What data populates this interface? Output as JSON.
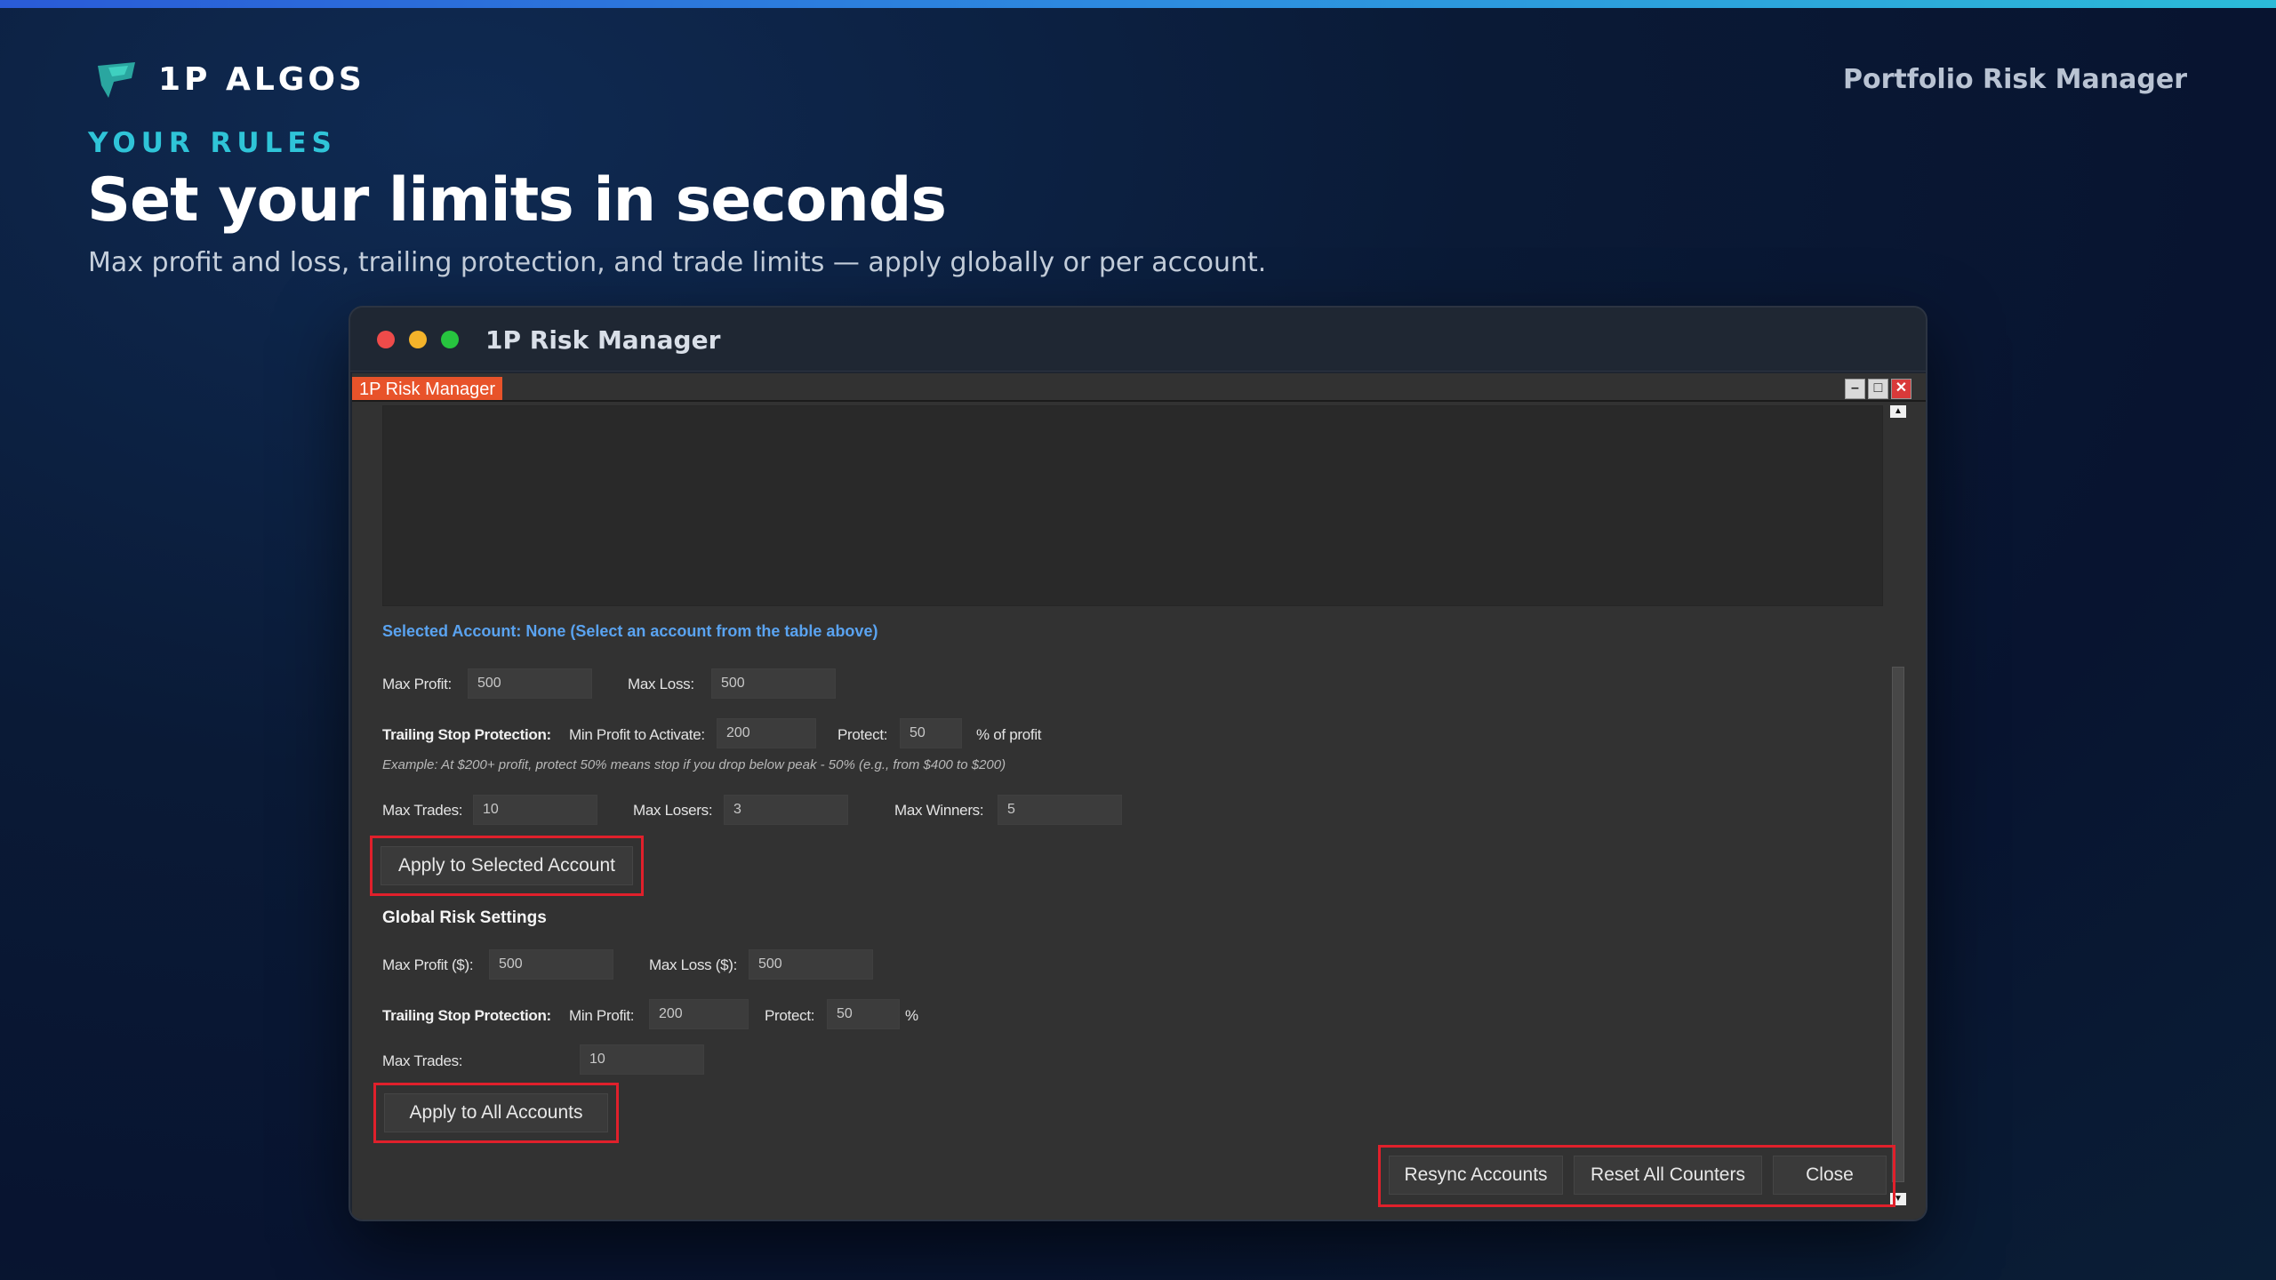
{
  "colors": {
    "accent_cyan": "#2fc4d8",
    "tab_orange": "#e8532a",
    "highlight_red": "#e0202b",
    "link_blue": "#5aa3f0"
  },
  "header": {
    "brand": "1P ALGOS",
    "brand_icon": "1p-logo-icon",
    "right_label": "Portfolio Risk Manager"
  },
  "hero": {
    "kicker": "YOUR RULES",
    "headline": "Set your limits in seconds",
    "subhead": "Max profit and loss, trailing protection, and trade limits — apply globally or per account."
  },
  "mac_window": {
    "title": "1P Risk Manager"
  },
  "app": {
    "tab_label": "1P Risk Manager",
    "window_controls": [
      "minimize-icon",
      "maximize-icon",
      "close-icon"
    ],
    "selected_account": {
      "heading": "Selected Account: None (Select an account from the table above)",
      "max_profit_label": "Max Profit:",
      "max_profit_value": "500",
      "max_loss_label": "Max Loss:",
      "max_loss_value": "500",
      "trailing_label": "Trailing Stop Protection:",
      "min_profit_label": "Min Profit to Activate:",
      "min_profit_value": "200",
      "protect_label": "Protect:",
      "protect_value": "50",
      "protect_suffix": "% of profit",
      "example": "Example: At $200+ profit, protect 50% means stop if you drop below peak - 50% (e.g., from $400 to $200)",
      "max_trades_label": "Max Trades:",
      "max_trades_value": "10",
      "max_losers_label": "Max Losers:",
      "max_losers_value": "3",
      "max_winners_label": "Max Winners:",
      "max_winners_value": "5",
      "apply_button": "Apply to Selected Account"
    },
    "global": {
      "heading": "Global Risk Settings",
      "max_profit_label": "Max Profit ($):",
      "max_profit_value": "500",
      "max_loss_label": "Max Loss ($):",
      "max_loss_value": "500",
      "trailing_label": "Trailing Stop Protection:",
      "min_profit_label": "Min Profit:",
      "min_profit_value": "200",
      "protect_label": "Protect:",
      "protect_value": "50",
      "protect_suffix": "%",
      "max_trades_label": "Max Trades:",
      "max_trades_value": "10",
      "apply_button": "Apply to All Accounts"
    },
    "footer_buttons": {
      "resync": "Resync Accounts",
      "reset": "Reset All Counters",
      "close": "Close"
    }
  }
}
